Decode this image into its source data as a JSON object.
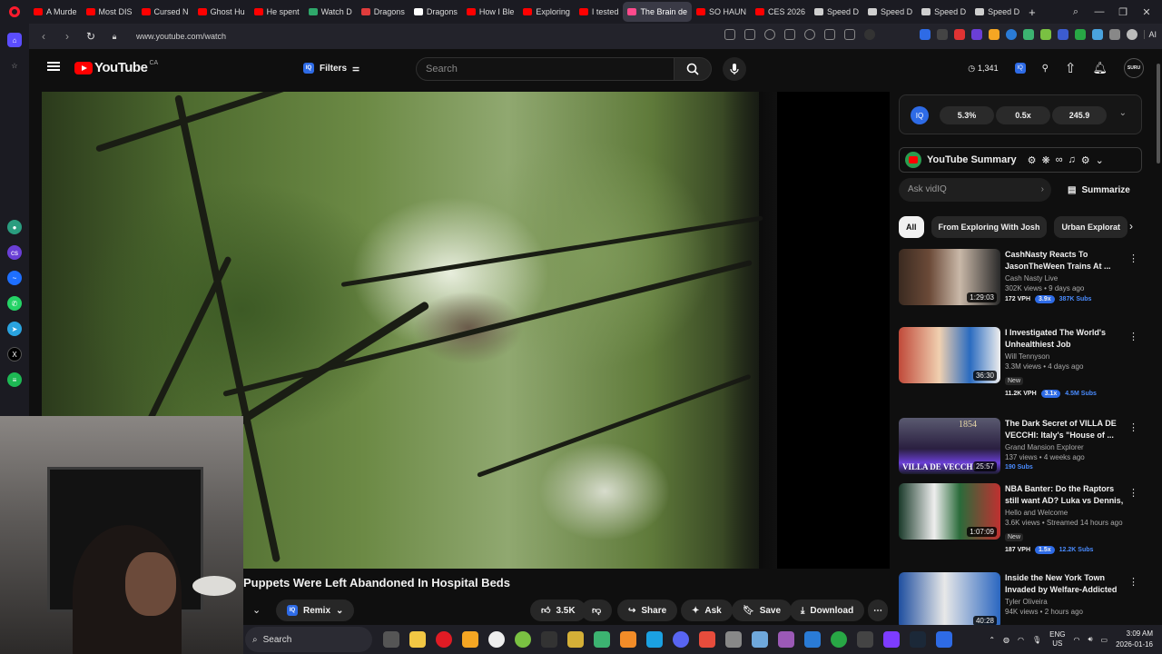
{
  "browser": {
    "tabs": [
      {
        "label": "A Murde",
        "color": "#ff0000"
      },
      {
        "label": "Most DIS",
        "color": "#ff0000"
      },
      {
        "label": "Cursed N",
        "color": "#ff0000"
      },
      {
        "label": "Ghost Hu",
        "color": "#ff0000"
      },
      {
        "label": "He spent",
        "color": "#ff0000"
      },
      {
        "label": "Watch D",
        "color": "#2fa86b"
      },
      {
        "label": "Dragons",
        "color": "#e03c3c"
      },
      {
        "label": "Dragons",
        "color": "#ffffff"
      },
      {
        "label": "How I Ble",
        "color": "#ff0000"
      },
      {
        "label": "Exploring",
        "color": "#ff0000"
      },
      {
        "label": "I tested",
        "color": "#ff0000"
      },
      {
        "label": "The Brain de",
        "color": "#ff4a8c",
        "active": true
      },
      {
        "label": "SO HAUN",
        "color": "#ff0000"
      },
      {
        "label": "CES 2026",
        "color": "#ff0000"
      },
      {
        "label": "Speed D",
        "color": "#cfcfcf"
      },
      {
        "label": "Speed D",
        "color": "#cfcfcf"
      },
      {
        "label": "Speed D",
        "color": "#cfcfcf"
      },
      {
        "label": "Speed D",
        "color": "#cfcfcf"
      }
    ],
    "new_tab": "+",
    "url": "www.youtube.com/watch",
    "ai_label": "AI"
  },
  "youtube": {
    "logo_text": "YouTube",
    "country": "CA",
    "filters_label": "Filters",
    "search_placeholder": "Search",
    "counter": "1,341",
    "avatar_text": "SURU"
  },
  "video": {
    "title": "Puppets Were Left Abandoned In Hospital Beds",
    "actions": {
      "remix": "Remix",
      "likes": "3.5K",
      "share": "Share",
      "ask": "Ask",
      "save": "Save",
      "download": "Download"
    }
  },
  "vidiq": {
    "stat1": "5.3%",
    "stat2": "0.5x",
    "stat3": "245.9"
  },
  "summary": {
    "title": "YouTube Summary",
    "ask_placeholder": "Ask vidIQ",
    "summarize": "Summarize"
  },
  "filter_chips": [
    "All",
    "From Exploring With Josh",
    "Urban Explorat"
  ],
  "recommendations": [
    {
      "title": "CashNasty Reacts To JasonTheWeen Trains At ...",
      "channel": "Cash Nasty Live",
      "meta": "302K views • 9 days ago",
      "duration": "1:29:03",
      "vph": "172 VPH",
      "mult": "3.9x",
      "subs": "387K Subs",
      "new": ""
    },
    {
      "title": "I Investigated The World's Unhealthiest Job",
      "channel": "Will Tennyson",
      "meta": "3.3M views • 4 days ago",
      "duration": "36:30",
      "vph": "11.2K VPH",
      "mult": "3.1x",
      "subs": "4.5M Subs",
      "new": "New"
    },
    {
      "title": "The Dark Secret of VILLA DE VECCHI: Italy's \"House of ...",
      "channel": "Grand Mansion Explorer",
      "meta": "137 views • 4 weeks ago",
      "duration": "25:57",
      "vph": "",
      "mult": "",
      "subs": "190 Subs",
      "new": ""
    },
    {
      "title": "NBA Banter: Do the Raptors still want AD? Luka vs Dennis, Spu...",
      "channel": "Hello and Welcome",
      "meta": "3.6K views • Streamed 14 hours ago",
      "duration": "1:07:09",
      "vph": "187 VPH",
      "mult": "1.5x",
      "subs": "12.2K Subs",
      "new": "New"
    },
    {
      "title": "Inside the New York Town Invaded by Welfare-Addicted ...",
      "channel": "Tyler Oliveira",
      "meta": "94K views • 2 hours ago",
      "duration": "40:28",
      "vph": "",
      "mult": "",
      "subs": "",
      "new": ""
    }
  ],
  "thumb_texts": {
    "villa": "VILLA DE VECCHI",
    "villa_year": "1854"
  },
  "taskbar": {
    "search": "Search",
    "lang1": "ENG",
    "lang2": "US",
    "time": "3:09 AM",
    "date": "2026-01-16"
  }
}
